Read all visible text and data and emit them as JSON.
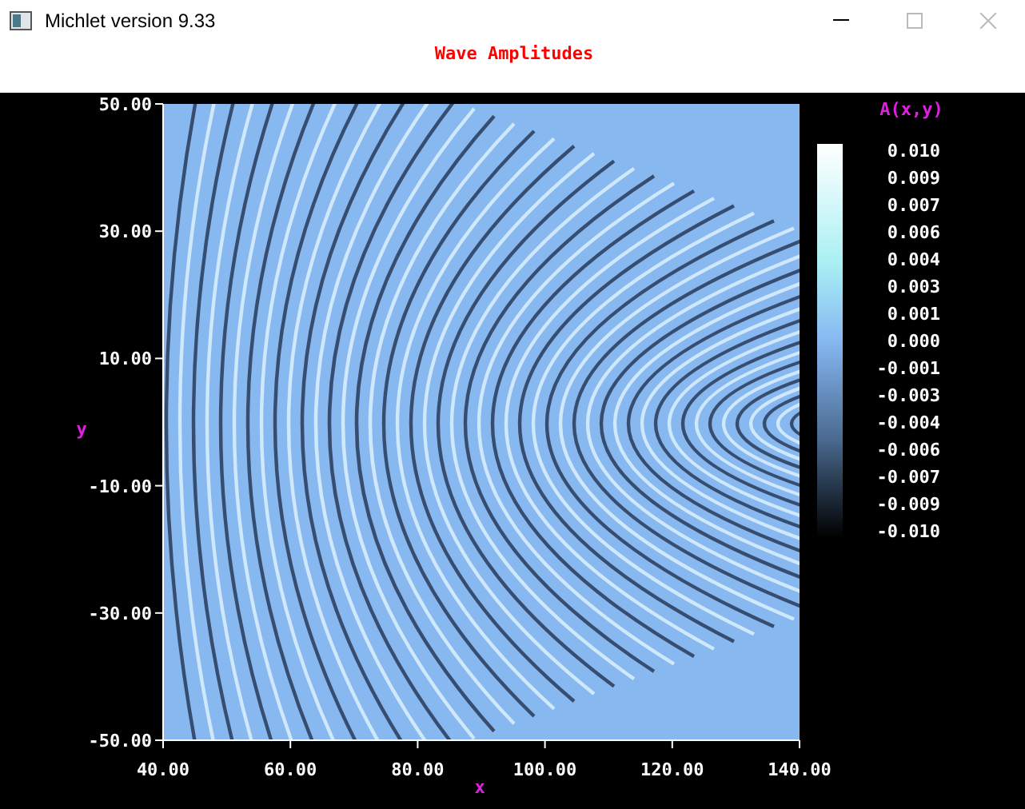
{
  "window": {
    "title": "Michlet version 9.33"
  },
  "plot": {
    "title": "Wave Amplitudes",
    "xlabel": "x",
    "ylabel": "y",
    "xticks": [
      "40.00",
      "60.00",
      "80.00",
      "100.00",
      "120.00",
      "140.00"
    ],
    "yticks": [
      "50.00",
      "30.00",
      "10.00",
      "-10.00",
      "-30.00",
      "-50.00"
    ]
  },
  "colorbar": {
    "label": "A(x,y)",
    "ticks": [
      "0.010",
      "0.009",
      "0.007",
      "0.006",
      "0.004",
      "0.003",
      "0.001",
      "0.000",
      "-0.001",
      "-0.003",
      "-0.004",
      "-0.006",
      "-0.007",
      "-0.009",
      "-0.010"
    ]
  }
}
